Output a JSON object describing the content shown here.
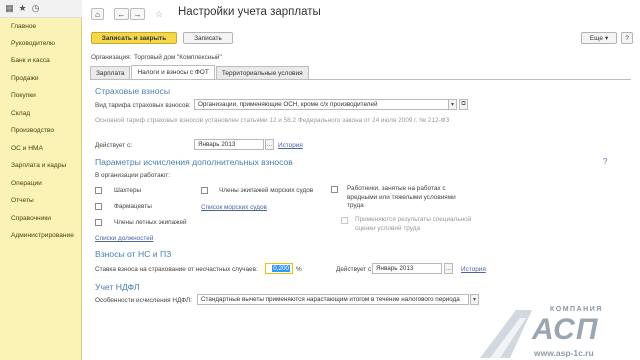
{
  "appbar": {
    "icons": [
      "apps-icon",
      "star-icon",
      "history-icon"
    ]
  },
  "sidebar": {
    "items": [
      {
        "label": "Главное"
      },
      {
        "label": "Руководителю"
      },
      {
        "label": "Банк и касса"
      },
      {
        "label": "Продажи"
      },
      {
        "label": "Покупки"
      },
      {
        "label": "Склад"
      },
      {
        "label": "Производство"
      },
      {
        "label": "ОС и НМА"
      },
      {
        "label": "Зарплата и кадры"
      },
      {
        "label": "Операции"
      },
      {
        "label": "Отчеты"
      },
      {
        "label": "Справочники"
      },
      {
        "label": "Администрирование"
      }
    ]
  },
  "header": {
    "title": "Настройки учета зарплаты"
  },
  "toolbar": {
    "save_close_label": "Записать и закрыть",
    "save_label": "Записать",
    "more_label": "Еще",
    "more_arrow": "▾",
    "help_label": "?"
  },
  "org": {
    "label": "Организация:",
    "value": "Торговый дом \"Комплексный\""
  },
  "tabs": [
    {
      "label": "Зарплата"
    },
    {
      "label": "Налоги и взносы с ФОТ"
    },
    {
      "label": "Территориальные условия"
    }
  ],
  "insurance": {
    "title": "Страховые взносы",
    "tariff_label": "Вид тарифа страховых взносов:",
    "tariff_value": "Организации, применяющие ОСН, кроме с/х производителей",
    "tariff_note": "Основной тариф страховых взносов установлен статьями 12 и 58.2 Федерального закона от 24 июля 2009 г. № 212-ФЗ",
    "effective_label": "Действует с:",
    "effective_value": "Январь 2013",
    "history_link": "История"
  },
  "additional": {
    "title": "Параметры исчисления дополнительных взносов",
    "help": "?",
    "works_label": "В организации работают:",
    "miners": "Шахтеры",
    "sea_crew": "Члены экипажей морских судов",
    "hazard_workers": "Работники, занятые на работах с вредными или тяжелыми условиями труда",
    "pharmacists": "Фармацевты",
    "ship_list_link": "Список морских судов",
    "flight_crew": "Члены летных экипажей",
    "special_eval": "Применяются результаты специальной оценки условий труда",
    "positions_link": "Списки должностей"
  },
  "accident": {
    "title": "Взносы от НС и ПЗ",
    "rate_label": "Ставка взноса на страхование от несчастных случаев:",
    "rate_value": "0,200",
    "percent": "%",
    "effective_label": "Действует с:",
    "effective_value": "Январь 2013",
    "history_link": "История"
  },
  "ndfl": {
    "title": "Учет НДФЛ",
    "calc_label": "Особенности исчисления НДФЛ:",
    "calc_value": "Стандартные вычеты применяются нарастающим итогом в течение налогового периода"
  },
  "logo": {
    "company_label": "КОМПАНИЯ",
    "brand": "АСП",
    "url": "www.asp-1c.ru",
    "brand_color": "#9aa6b2"
  }
}
